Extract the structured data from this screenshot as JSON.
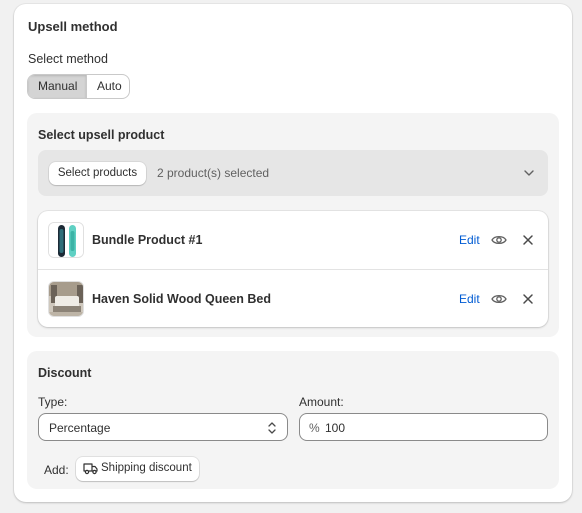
{
  "card": {
    "title": "Upsell method",
    "select_label": "Select method",
    "methods": [
      "Manual",
      "Auto"
    ],
    "selected_method": "Manual"
  },
  "upsell": {
    "title": "Select upsell product",
    "select_button": "Select products",
    "selected_count": "2 product(s) selected",
    "products": [
      {
        "name": "Bundle Product #1",
        "edit": "Edit",
        "thumb": "snowboard-image"
      },
      {
        "name": "Haven Solid Wood Queen Bed",
        "edit": "Edit",
        "thumb": "bed-image"
      }
    ]
  },
  "discount": {
    "title": "Discount",
    "type_label": "Type:",
    "type_value": "Percentage",
    "amount_label": "Amount:",
    "amount_prefix": "%",
    "amount_value": "100",
    "add_label": "Add:",
    "shipping_button": "Shipping discount"
  },
  "colors": {
    "link": "#005bd3",
    "panel_bg": "#f4f4f4",
    "card_bg": "#ffffff"
  }
}
